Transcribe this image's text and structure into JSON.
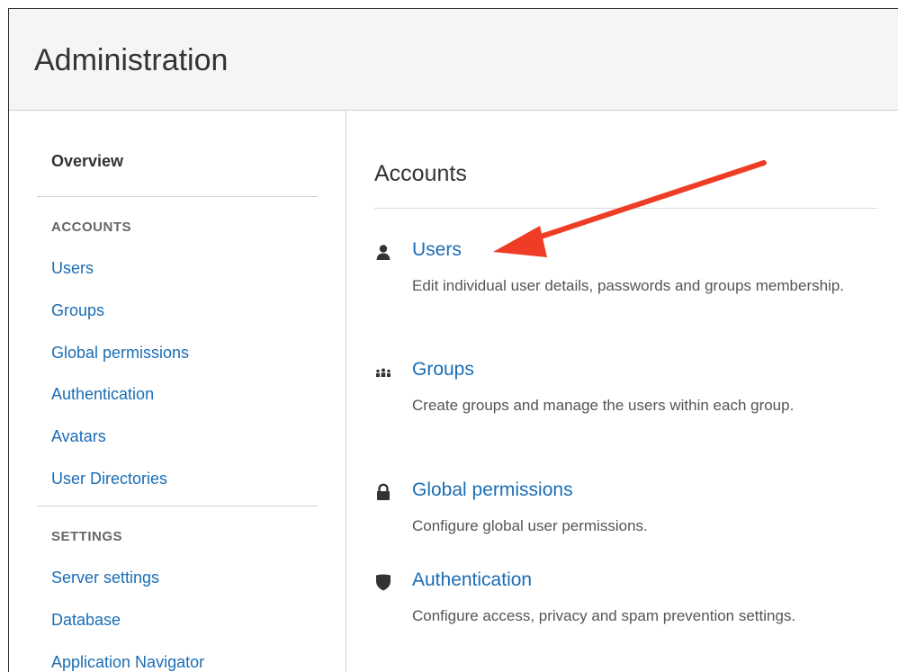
{
  "header": {
    "title": "Administration"
  },
  "sidebar": {
    "overview": "Overview",
    "sections": [
      {
        "heading": "ACCOUNTS",
        "items": [
          {
            "label": "Users"
          },
          {
            "label": "Groups"
          },
          {
            "label": "Global permissions"
          },
          {
            "label": "Authentication"
          },
          {
            "label": "Avatars"
          },
          {
            "label": "User Directories"
          }
        ]
      },
      {
        "heading": "SETTINGS",
        "items": [
          {
            "label": "Server settings"
          },
          {
            "label": "Database"
          },
          {
            "label": "Application Navigator"
          }
        ]
      }
    ]
  },
  "main": {
    "title": "Accounts",
    "entries": [
      {
        "icon": "user-icon",
        "label": "Users",
        "description": "Edit individual user details, passwords and groups membership."
      },
      {
        "icon": "groups-icon",
        "label": "Groups",
        "description": "Create groups and manage the users within each group."
      },
      {
        "icon": "lock-icon",
        "label": "Global permissions",
        "description": "Configure global user permissions."
      },
      {
        "icon": "shield-icon",
        "label": "Authentication",
        "description": "Configure access, privacy and spam prevention settings."
      }
    ]
  },
  "colors": {
    "link": "#1a6db5",
    "header_bg": "#f5f5f5",
    "annotation_arrow": "#ee3d24"
  }
}
